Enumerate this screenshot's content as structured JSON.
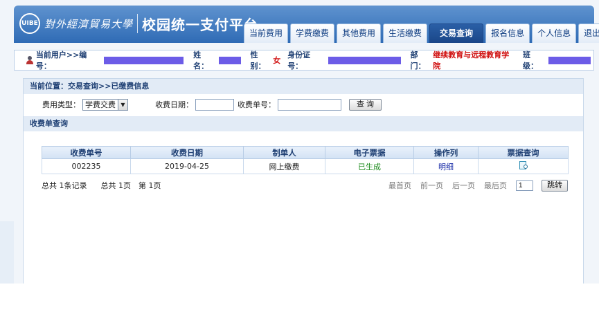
{
  "header": {
    "logo_cursive": "對外經濟貿易大學",
    "logo_emblem": "UIBE",
    "title": "校园统一支付平台",
    "nav": [
      "当前费用",
      "学费缴费",
      "其他费用",
      "生活缴费",
      "交易查询",
      "报名信息",
      "个人信息",
      "退出登录"
    ],
    "active_tab": "交易查询"
  },
  "userbar": {
    "current_user_label": "当前用户>>编号：",
    "name_label": "姓名：",
    "gender_label": "性别：",
    "gender_value": "女",
    "id_label": "身份证号：",
    "dept_label": "部门：",
    "dept_value": "继续教育与远程教育学院",
    "class_label": "班级："
  },
  "breadcrumb": "当前位置：交易查询>>已缴费信息",
  "filters": {
    "fee_type_label": "费用类型：",
    "fee_type_value": "学费交费",
    "date_label": "收费日期：",
    "receipt_no_label": "收费单号：",
    "query_button": "查 询"
  },
  "section_title": "收费单查询",
  "table": {
    "headers": [
      "收费单号",
      "收费日期",
      "制单人",
      "电子票据",
      "操作列",
      "票据查询"
    ],
    "rows": [
      {
        "receipt_no": "002235",
        "date": "2019-04-25",
        "maker": "网上缴费",
        "e_invoice": "已生成",
        "action": "明细"
      }
    ]
  },
  "pager": {
    "total_records": "总共 1条记录",
    "total_pages": "总共 1页",
    "current_page": "第 1页",
    "first": "最首页",
    "prev": "前一页",
    "next": "后一页",
    "last": "最后页",
    "page_input": "1",
    "jump_button": "跳转"
  },
  "colors": {
    "header_blue": "#2f6bb5",
    "active_tab": "#1a4688",
    "highlight_red": "#d01010",
    "status_green": "#1b8a1b",
    "redaction": "#6c5ce7"
  }
}
